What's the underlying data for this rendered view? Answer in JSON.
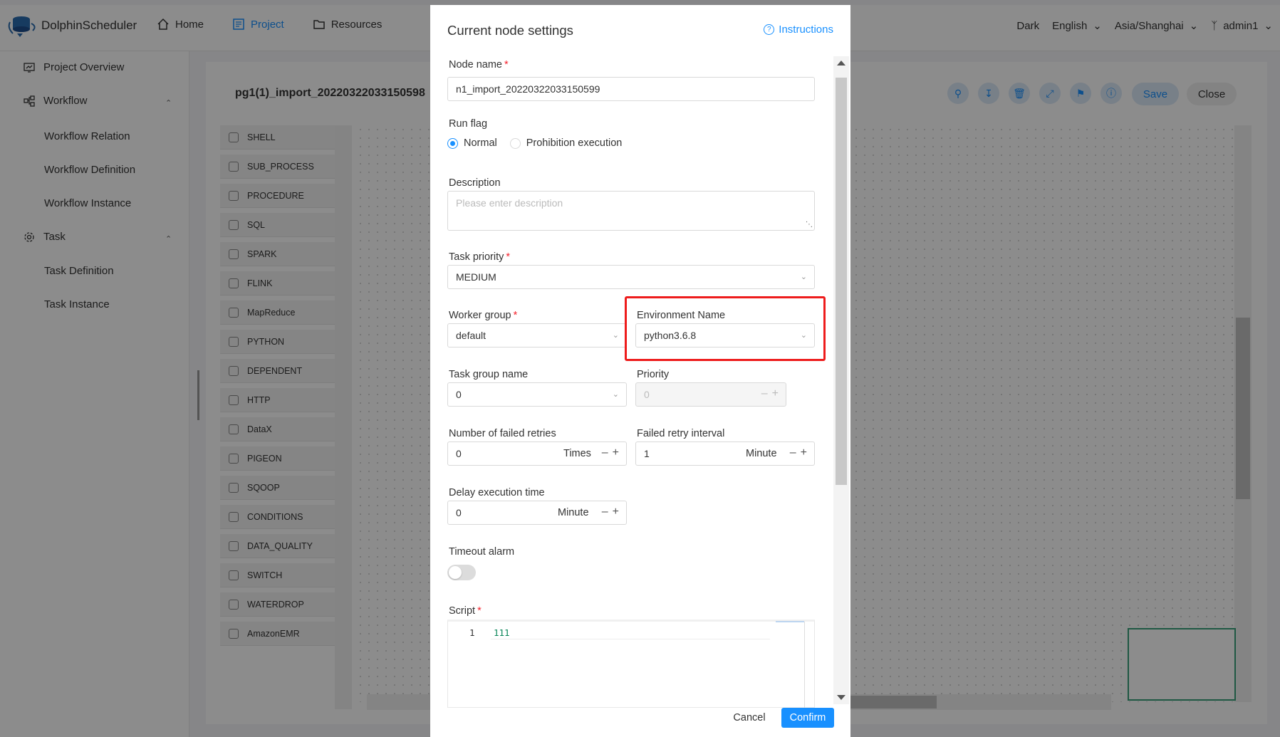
{
  "app": {
    "logo_text": "DolphinScheduler",
    "nav": [
      {
        "label": "Home",
        "icon": "home-icon"
      },
      {
        "label": "Project",
        "icon": "project-icon"
      },
      {
        "label": "Resources",
        "icon": "folder-icon"
      }
    ],
    "topright": {
      "theme": "Dark",
      "language": "English",
      "timezone": "Asia/Shanghai",
      "user": "admin1"
    },
    "sidebar": {
      "project_overview": "Project Overview",
      "workflow": "Workflow",
      "workflow_items": [
        "Workflow Relation",
        "Workflow Definition",
        "Workflow Instance"
      ],
      "task": "Task",
      "task_items": [
        "Task Definition",
        "Task Instance"
      ]
    },
    "workflow_title": "pg1(1)_import_20220322033150598",
    "toolbar": {
      "save": "Save",
      "close": "Close"
    },
    "task_types": [
      "SHELL",
      "SUB_PROCESS",
      "PROCEDURE",
      "SQL",
      "SPARK",
      "FLINK",
      "MapReduce",
      "PYTHON",
      "DEPENDENT",
      "HTTP",
      "DataX",
      "PIGEON",
      "SQOOP",
      "CONDITIONS",
      "DATA_QUALITY",
      "SWITCH",
      "WATERDROP",
      "AmazonEMR"
    ]
  },
  "drawer": {
    "title": "Current node settings",
    "instructions": "Instructions",
    "node_name_label": "Node name",
    "node_name_value": "n1_import_20220322033150599",
    "run_flag_label": "Run flag",
    "run_flag_options": [
      "Normal",
      "Prohibition execution"
    ],
    "run_flag_selected": "Normal",
    "description_label": "Description",
    "description_placeholder": "Please enter description",
    "task_priority_label": "Task priority",
    "task_priority_value": "MEDIUM",
    "worker_group_label": "Worker group",
    "worker_group_value": "default",
    "environment_name_label": "Environment Name",
    "environment_name_value": "python3.6.8",
    "task_group_name_label": "Task group name",
    "task_group_name_value": "0",
    "priority_label": "Priority",
    "priority_value": "0",
    "failed_retries_label": "Number of failed retries",
    "failed_retries_value": "0",
    "failed_retries_unit": "Times",
    "retry_interval_label": "Failed retry interval",
    "retry_interval_value": "1",
    "retry_interval_unit": "Minute",
    "delay_label": "Delay execution time",
    "delay_value": "0",
    "delay_unit": "Minute",
    "timeout_label": "Timeout alarm",
    "timeout_enabled": false,
    "script_label": "Script",
    "script_line_number": "1",
    "script_code": "111",
    "cancel": "Cancel",
    "confirm": "Confirm",
    "highlight_color": "#ee1c1c",
    "accent_color": "#1890ff"
  }
}
